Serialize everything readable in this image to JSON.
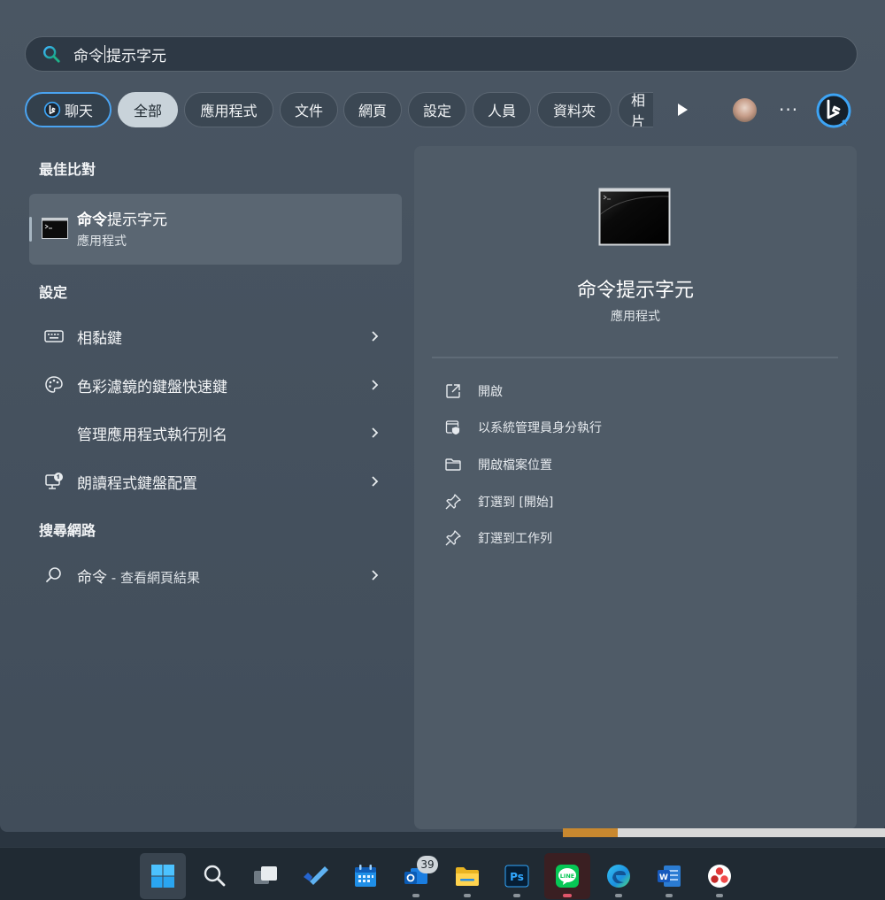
{
  "search": {
    "typed": "命令",
    "suggestion": "提示字元"
  },
  "chips": {
    "chat": "聊天",
    "all": "全部",
    "apps": "應用程式",
    "docs": "文件",
    "web": "網頁",
    "settings": "設定",
    "people": "人員",
    "folders": "資料夾",
    "photos": "相片"
  },
  "sections": {
    "best_match": "最佳比對",
    "settings": "設定",
    "web": "搜尋網路"
  },
  "best_match": {
    "title_bold": "命令",
    "title_rest": "提示字元",
    "type": "應用程式"
  },
  "settings_results": [
    {
      "label": "相黏鍵",
      "icon": "keyboard-icon"
    },
    {
      "label": "色彩濾鏡的鍵盤快速鍵",
      "icon": "palette-icon"
    },
    {
      "label": "管理應用程式執行別名",
      "icon": ""
    },
    {
      "label": "朗讀程式鍵盤配置",
      "icon": "narrator-icon"
    }
  ],
  "web_result": {
    "query": "命令",
    "suffix": " - 查看網頁結果"
  },
  "preview": {
    "title": "命令提示字元",
    "type": "應用程式",
    "actions": [
      {
        "label": "開啟",
        "icon": "open-external-icon"
      },
      {
        "label": "以系統管理員身分執行",
        "icon": "shield-icon"
      },
      {
        "label": "開啟檔案位置",
        "icon": "folder-icon"
      },
      {
        "label": "釘選到 [開始]",
        "icon": "pin-icon"
      },
      {
        "label": "釘選到工作列",
        "icon": "pin-icon"
      }
    ]
  },
  "taskbar": {
    "items": [
      "start",
      "search",
      "task-view",
      "todo",
      "calendar",
      "outlook",
      "file-explorer",
      "photoshop",
      "line",
      "edge",
      "word",
      "davinci"
    ],
    "mail_badge": "39",
    "photoshop_label": "Ps",
    "line_label": "LINE",
    "word_label": "W"
  },
  "colors": {
    "accent_blue": "#4aa3f0",
    "line_green": "#06c755",
    "panel_bg": "#46525f"
  }
}
